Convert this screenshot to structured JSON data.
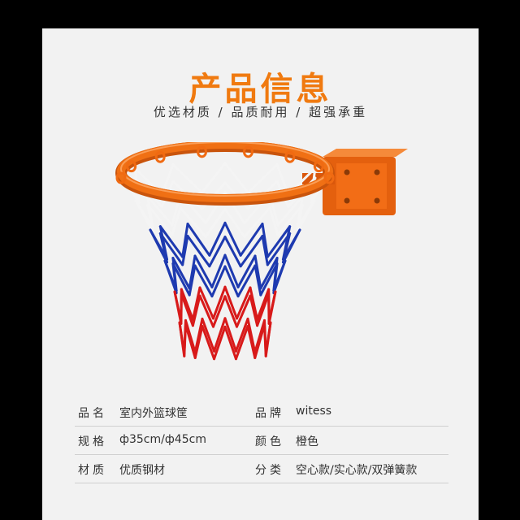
{
  "title": "产品信息",
  "subtitle": "优选材质 / 品质耐用 / 超强承重",
  "colors": {
    "accent": "#f07a10",
    "rim": "#f06a12",
    "net_white": "#f4f4f4",
    "net_blue": "#1e3ab0",
    "net_red": "#d81a1a"
  },
  "specs": [
    {
      "label": "品名",
      "value": "室内外篮球筐",
      "label2": "品牌",
      "value2": "witess"
    },
    {
      "label": "规格",
      "value": "ф35cm/ф45cm",
      "label2": "颜色",
      "value2": "橙色"
    },
    {
      "label": "材质",
      "value": "优质钢材",
      "label2": "分类",
      "value2": "空心款/实心款/双弹簧款"
    }
  ]
}
